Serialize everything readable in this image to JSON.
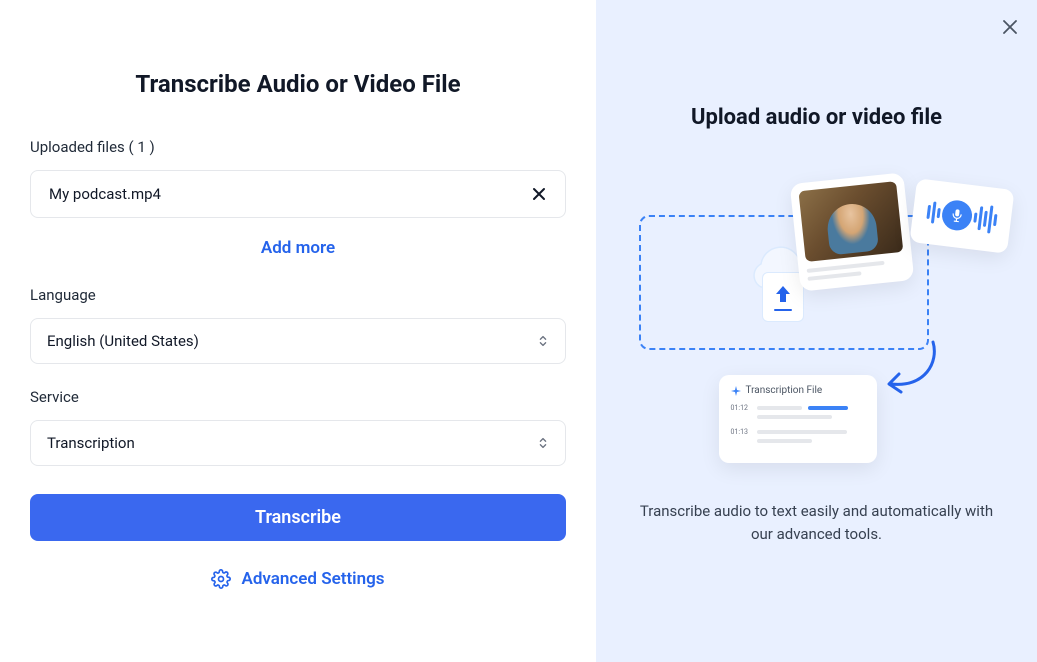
{
  "left": {
    "title": "Transcribe Audio or Video File",
    "uploaded_label": "Uploaded files ( 1 )",
    "file_name": "My podcast.mp4",
    "add_more": "Add more",
    "language_label": "Language",
    "language_value": "English (United States)",
    "service_label": "Service",
    "service_value": "Transcription",
    "transcribe_button": "Transcribe",
    "advanced_label": "Advanced Settings"
  },
  "right": {
    "title": "Upload audio or video file",
    "description": "Transcribe audio to text easily and automatically with our advanced tools.",
    "trans_card_title": "Transcription File",
    "trans_time_1": "01:12",
    "trans_time_2": "01:13"
  }
}
